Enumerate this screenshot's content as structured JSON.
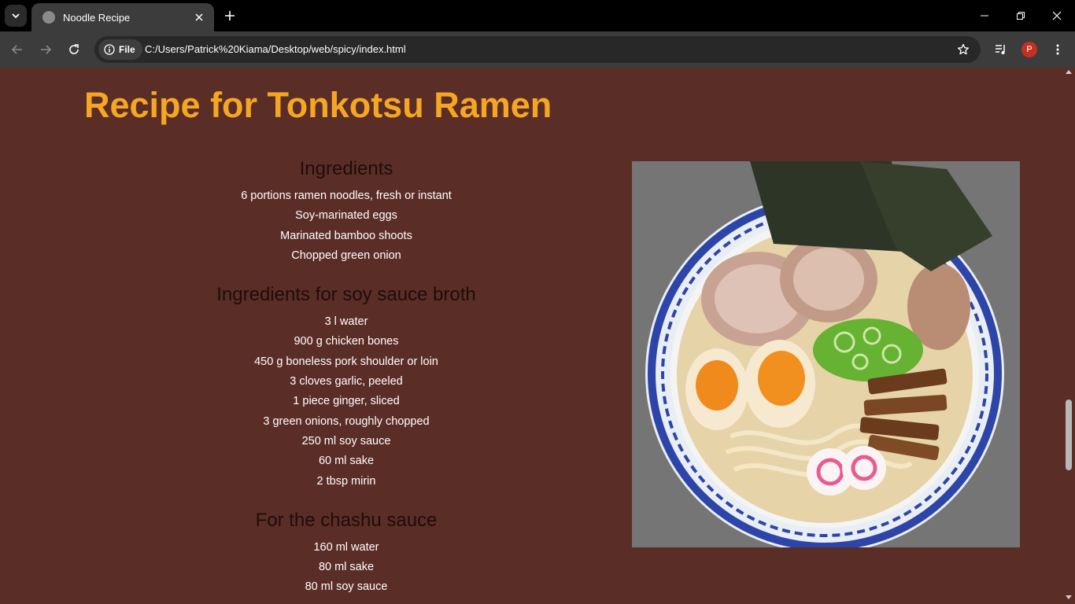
{
  "browser": {
    "tab_title": "Noodle Recipe",
    "security_chip": "File",
    "url": "C:/Users/Patrick%20Kiama/Desktop/web/spicy/index.html",
    "profile_initial": "P"
  },
  "page": {
    "title": "Recipe for Tonkotsu Ramen",
    "sections": [
      {
        "heading": "Ingredients",
        "items": [
          "6 portions ramen noodles, fresh or instant",
          "Soy-marinated eggs",
          "Marinated bamboo shoots",
          "Chopped green onion"
        ]
      },
      {
        "heading": "Ingredients for soy sauce broth",
        "items": [
          "3 l water",
          "900 g chicken bones",
          "450 g boneless pork shoulder or loin",
          "3 cloves garlic, peeled",
          "1 piece ginger, sliced",
          "3 green onions, roughly chopped",
          "250 ml soy sauce",
          "60 ml sake",
          "2 tbsp mirin"
        ]
      },
      {
        "heading": "For the chashu sauce",
        "items": [
          "160 ml water",
          "80 ml sake",
          "80 ml soy sauce"
        ]
      }
    ]
  },
  "colors": {
    "page_background": "#5b2d27",
    "title": "#f5a623",
    "heading": "#1e0d0a",
    "text": "#ffffff"
  }
}
